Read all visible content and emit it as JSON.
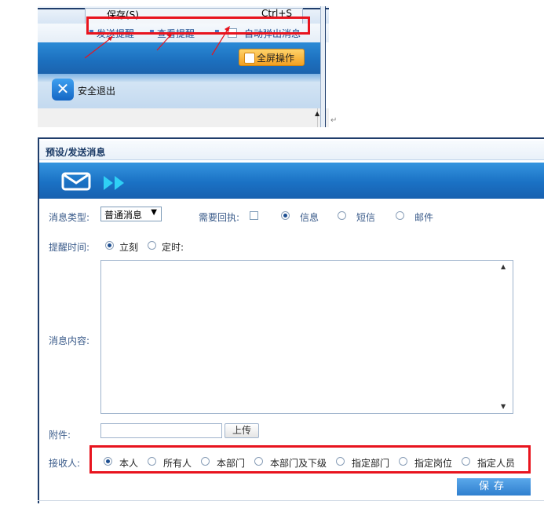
{
  "top_screenshot": {
    "menu_save": "保存(S)",
    "menu_shortcut": "Ctrl+S",
    "send_reminder": "发送提醒",
    "view_reminder": "查看提醒",
    "auto_popup": "自动弹出消息",
    "fullscreen_btn": "全屏操作",
    "exit_label": "安全退出",
    "highlight_color": "#e8141e"
  },
  "form": {
    "title": "预设/发送消息",
    "msg_type_label": "消息类型:",
    "msg_type_value": "普通消息",
    "need_receipt_label": "需要回执:",
    "channels": [
      "信息",
      "短信",
      "邮件"
    ],
    "remind_time_label": "提醒时间:",
    "remind_options": [
      "立刻",
      "定时:"
    ],
    "content_label": "消息内容:",
    "attachment_label": "附件:",
    "upload_btn": "上传",
    "recipient_label": "接收人:",
    "recipients": [
      "本人",
      "所有人",
      "本部门",
      "本部门及下级",
      "指定部门",
      "指定岗位",
      "指定人员"
    ],
    "save_btn": "保存",
    "accent_color": "#1a71c4"
  }
}
